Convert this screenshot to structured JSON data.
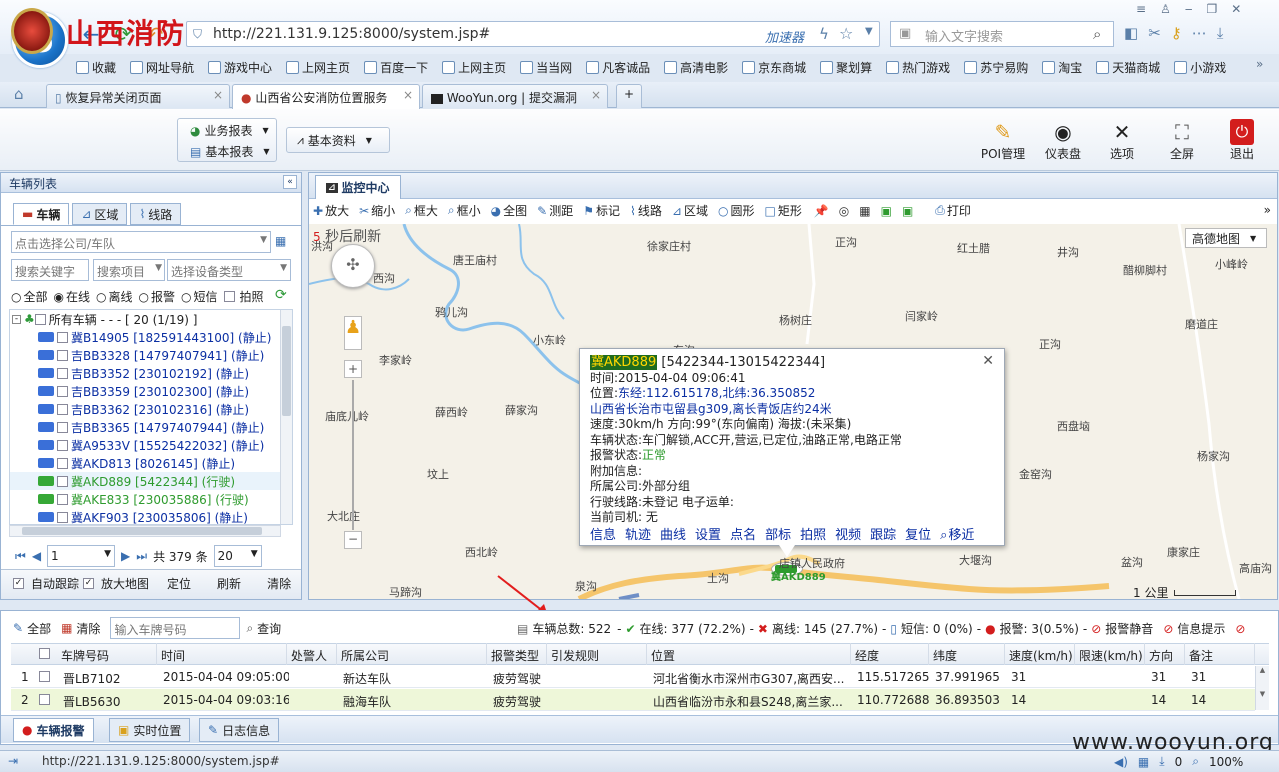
{
  "browser": {
    "url": "http://221.131.9.125:8000/system.jsp#",
    "accelerator": "加速器",
    "search_placeholder": "输入文字搜索",
    "bookmarks": [
      "收藏",
      "网址导航",
      "游戏中心",
      "上网主页",
      "百度一下",
      "上网主页",
      "当当网",
      "凡客诚品",
      "高清电影",
      "京东商城",
      "聚划算",
      "热门游戏",
      "苏宁易购",
      "淘宝",
      "天猫商城",
      "小游戏"
    ],
    "tabs": [
      "恢复异常关闭页面",
      "山西省公安消防位置服务",
      "WooYun.org | 提交漏洞"
    ]
  },
  "app": {
    "title": "山西消防",
    "menu": {
      "business_report": "业务报表",
      "basic_report": "基本报表",
      "basic_data": "基本资料"
    },
    "header_buttons": [
      "POI管理",
      "仪表盘",
      "选项",
      "全屏",
      "退出"
    ]
  },
  "left": {
    "panel_title": "车辆列表",
    "tabs": [
      "车辆",
      "区域",
      "线路"
    ],
    "company_placeholder": "点击选择公司/车队",
    "search_keyword": "搜索关键字",
    "search_item": "搜索项目",
    "device_type": "选择设备类型",
    "filters": [
      "全部",
      "在线",
      "离线",
      "报警",
      "短信",
      "拍照"
    ],
    "tree_root": "所有车辆 - - - [ 20 (1/19) ]",
    "vehicles": [
      {
        "text": "冀B14905 [182591443100] (静止)",
        "color": "#0b2fa3",
        "car": "#3a6fd8"
      },
      {
        "text": "吉BB3328 [14797407941] (静止)",
        "color": "#0b2fa3",
        "car": "#3a6fd8"
      },
      {
        "text": "吉BB3352 [230102192] (静止)",
        "color": "#0b2fa3",
        "car": "#3a6fd8"
      },
      {
        "text": "吉BB3359 [230102300] (静止)",
        "color": "#0b2fa3",
        "car": "#3a6fd8"
      },
      {
        "text": "吉BB3362 [230102316] (静止)",
        "color": "#0b2fa3",
        "car": "#3a6fd8"
      },
      {
        "text": "吉BB3365 [14797407944] (静止)",
        "color": "#0b2fa3",
        "car": "#3a6fd8"
      },
      {
        "text": "冀A9533V [15525422032] (静止)",
        "color": "#0b2fa3",
        "car": "#3a6fd8"
      },
      {
        "text": "冀AKD813 [8026145] (静止)",
        "color": "#0b2fa3",
        "car": "#3a6fd8"
      },
      {
        "text": "冀AKD889 [5422344] (行驶)",
        "color": "#2e9b2e",
        "car": "#36a836"
      },
      {
        "text": "冀AKE833 [230035886] (行驶)",
        "color": "#2e9b2e",
        "car": "#36a836"
      },
      {
        "text": "冀AKF903 [230035806] (静止)",
        "color": "#0b2fa3",
        "car": "#3a6fd8"
      }
    ],
    "pager": {
      "page": "1",
      "total": "共 379 条",
      "size": "20"
    },
    "bottom": {
      "auto_follow": "自动跟踪",
      "zoom_map": "放大地图",
      "locate": "定位",
      "refresh": "刷新",
      "clear": "清除"
    }
  },
  "center": {
    "tab": "监控中心",
    "toolbar": [
      "放大",
      "缩小",
      "框大",
      "框小",
      "全图",
      "测距",
      "标记",
      "线路",
      "区域",
      "圆形",
      "矩形",
      "打印"
    ],
    "refresh_count": "5",
    "refresh_text": "秒后刷新",
    "map_type": "高德地图",
    "scale": "1 公里",
    "places": [
      {
        "t": "洪沟"
      },
      {
        "t": "唐王庙村"
      },
      {
        "t": "徐家庄村"
      },
      {
        "t": "正沟"
      },
      {
        "t": "红土腊"
      },
      {
        "t": "井沟"
      },
      {
        "t": "醋柳脚村"
      },
      {
        "t": "小峰岭"
      },
      {
        "t": "西沟"
      },
      {
        "t": "鸦儿沟"
      },
      {
        "t": "杨树庄"
      },
      {
        "t": "闫家岭"
      },
      {
        "t": "磨道庄"
      },
      {
        "t": "小东岭"
      },
      {
        "t": "东沟"
      },
      {
        "t": "正沟"
      },
      {
        "t": "李家岭"
      },
      {
        "t": "庙底儿岭"
      },
      {
        "t": "薛西岭"
      },
      {
        "t": "薛家沟"
      },
      {
        "t": "西盘垴"
      },
      {
        "t": "杨家沟"
      },
      {
        "t": "坟上"
      },
      {
        "t": "金窑沟"
      },
      {
        "t": "大北庄"
      },
      {
        "t": "西北岭"
      },
      {
        "t": "大堰沟"
      },
      {
        "t": "盆沟"
      },
      {
        "t": "康家庄"
      },
      {
        "t": "马蹄沟"
      },
      {
        "t": "泉沟"
      },
      {
        "t": "土沟"
      },
      {
        "t": "高庙沟"
      }
    ],
    "popup": {
      "plate": "冀AKD889",
      "ids": "[5422344-13015422344]",
      "time": "时间:2015-04-04 09:06:41",
      "pos_label": "位置:",
      "pos_coords": "东经:112.615178,北纬:36.350852",
      "pos_address": "山西省长治市屯留县g309,离长青饭店约24米",
      "speed": "速度:30km/h    方向:99°(东向偏南)    海拔:(未采集)",
      "vehicle_status": "车辆状态:车门解锁,ACC开,营运,已定位,油路正常,电路正常",
      "alarm_label": "报警状态:",
      "alarm_value": "正常",
      "extra": "附加信息:",
      "company": "所属公司:外部分组",
      "route": "行驶线路:未登记    电子运单:",
      "driver": "当前司机: 无",
      "links": [
        "信息",
        "轨迹",
        "曲线",
        "设置",
        "点名",
        "部标",
        "拍照",
        "视频",
        "跟踪",
        "复位",
        "移近"
      ]
    },
    "marker_label": "店镇人民政府",
    "marker_plate": "冀AKD889"
  },
  "grid": {
    "toolbar": {
      "all": "全部",
      "clear": "清除",
      "plate_placeholder": "输入车牌号码",
      "query": "查询"
    },
    "stats": {
      "total": "车辆总数: 522",
      "online": "在线: 377 (72.2%)",
      "offline": "离线: 145 (27.7%)",
      "sms": "短信: 0 (0%)",
      "alarm": "报警: 3(0.5%)",
      "mute": "报警静音",
      "notice": "信息提示"
    },
    "columns": [
      "车牌号码",
      "时间",
      "处警人",
      "所属公司",
      "报警类型",
      "引发规则",
      "位置",
      "经度",
      "纬度",
      "速度(km/h)",
      "限速(km/h)",
      "方向",
      "备注"
    ],
    "rows": [
      [
        "1",
        "晋LB7102",
        "2015-04-04 09:05:00",
        "",
        "新达车队",
        "疲劳驾驶",
        "",
        "河北省衡水市深州市G307,离西安...",
        "115.517265",
        "37.991965",
        "31",
        "",
        "31",
        "31"
      ],
      [
        "2",
        "晋LB5630",
        "2015-04-04 09:03:16",
        "",
        "融海车队",
        "疲劳驾驶",
        "",
        "山西省临汾市永和县S248,离兰家...",
        "110.772688",
        "36.893503",
        "14",
        "",
        "14",
        "14"
      ]
    ],
    "bottom_tabs": [
      "车辆报警",
      "实时位置",
      "日志信息"
    ]
  },
  "status": {
    "url": "http://221.131.9.125:8000/system.jsp#",
    "zoom": "100%",
    "count": "0"
  },
  "watermark": "www.wooyun.org"
}
